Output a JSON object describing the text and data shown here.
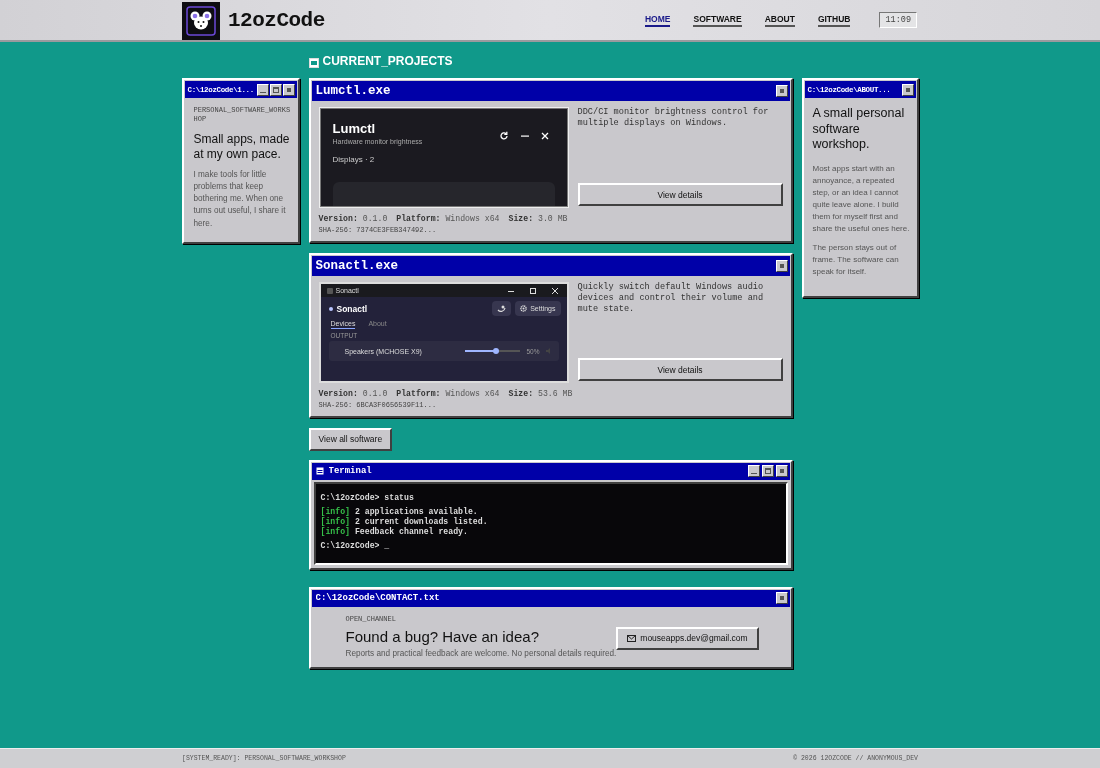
{
  "header": {
    "logo_text": "12ozCode",
    "nav": [
      {
        "label": "HOME",
        "selected": true
      },
      {
        "label": "SOFTWARE",
        "selected": false
      },
      {
        "label": "ABOUT",
        "selected": false
      },
      {
        "label": "GITHUB",
        "selected": false
      }
    ],
    "clock": "11:09"
  },
  "intro_window": {
    "title": "C:\\12ozCode\\1...",
    "eyebrow": "PERSONAL_SOFTWARE_WORKSHOP",
    "heading": "Small apps, made at my own pace.",
    "body": "I make tools for little problems that keep bothering me. When one turns out useful, I share it here."
  },
  "section_title": "CURRENT_PROJECTS",
  "projects": [
    {
      "title": "Lumctl.exe",
      "screenshot": {
        "kind": "lumctl",
        "title": "Lumctl",
        "subtitle": "Hardware monitor brightness",
        "section": "Displays · 2"
      },
      "description": "DDC/CI monitor brightness control for multiple displays on Windows.",
      "button": "View details",
      "meta": [
        {
          "label": "Version:",
          "value": "0.1.0"
        },
        {
          "label": "Platform:",
          "value": "Windows x64"
        },
        {
          "label": "Size:",
          "value": "3.0 MB"
        }
      ],
      "sha": "SHA-256: 7374CE3FEB347492..."
    },
    {
      "title": "Sonactl.exe",
      "screenshot": {
        "kind": "sonactl",
        "window_title": "Sonactl",
        "app_name": "Sonactl",
        "settings": "Settings",
        "tabs": [
          {
            "label": "Devices",
            "selected": true
          },
          {
            "label": "About",
            "selected": false
          }
        ],
        "group": "OUTPUT",
        "device": "Speakers (MCHOSE X9)",
        "level": 0.55,
        "reading": "50%"
      },
      "description": "Quickly switch default Windows audio devices and control their volume and mute state.",
      "button": "View details",
      "meta": [
        {
          "label": "Version:",
          "value": "0.1.0"
        },
        {
          "label": "Platform:",
          "value": "Windows x64"
        },
        {
          "label": "Size:",
          "value": "53.6 MB"
        }
      ],
      "sha": "SHA-256: 6BCA3F0656539F11..."
    }
  ],
  "view_all": "View all software",
  "terminal": {
    "title": "Terminal",
    "lines": [
      {
        "kind": "prompt",
        "text": "C:\\12ozCode> status"
      },
      {
        "kind": "info",
        "tag": "[info]",
        "text": "2 applications available."
      },
      {
        "kind": "info",
        "tag": "[info]",
        "text": "2 current downloads listed."
      },
      {
        "kind": "info",
        "tag": "[info]",
        "text": "Feedback channel ready."
      },
      {
        "kind": "prompt",
        "text": "C:\\12ozCode> _"
      }
    ]
  },
  "contact": {
    "title": "C:\\12ozCode\\CONTACT.txt",
    "eyebrow": "OPEN_CHANNEL",
    "heading": "Found a bug? Have an idea?",
    "body": "Reports and practical feedback are welcome. No personal details required.",
    "email": "mouseapps.dev@gmail.com"
  },
  "about_window": {
    "title": "C:\\12ozCode\\ABOUT...",
    "heading": "A small personal software workshop.",
    "paragraphs": [
      "Most apps start with an annoyance, a repeated step, or an idea I cannot quite leave alone. I build them for myself first and share the useful ones here.",
      "The person stays out of frame. The software can speak for itself."
    ]
  },
  "footer": {
    "left": "[SYSTEM_READY]: PERSONAL_SOFTWARE_WORKSHOP",
    "right": "© 2026 12OZCODE // ANONYMOUS_DEV"
  }
}
